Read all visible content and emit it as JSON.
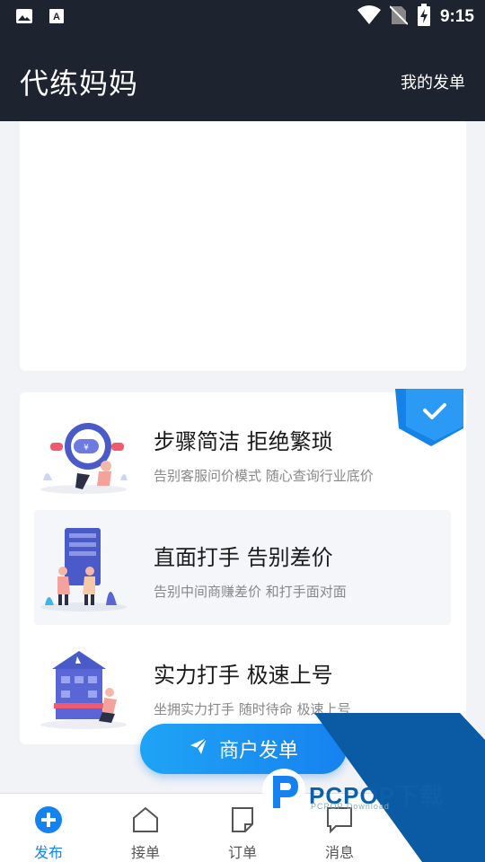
{
  "status_bar": {
    "time": "9:15",
    "left_icons": [
      "image-icon",
      "font-icon"
    ],
    "right_icons": [
      "wifi-icon",
      "no-sim-icon",
      "battery-charging-icon"
    ]
  },
  "header": {
    "title": "代练妈妈",
    "my_orders_label": "我的发单"
  },
  "features": [
    {
      "title": "步骤简洁 拒绝繁琐",
      "desc": "告别客服问价模式 随心查询行业底价",
      "icon": "currency-bubble-illustration"
    },
    {
      "title": "直面打手 告别差价",
      "desc": "告别中间商赚差价 和打手面对面",
      "icon": "handshake-illustration"
    },
    {
      "title": "实力打手 极速上号",
      "desc": "坐拥实力打手 随时待命 极速上号",
      "icon": "building-illustration"
    }
  ],
  "badge_icon": "check-ribbon-icon",
  "merchant_button": {
    "label": "商户发单",
    "icon": "paper-plane-icon"
  },
  "bottom_nav": [
    {
      "label": "发布",
      "icon": "plus-circle-icon",
      "active": true
    },
    {
      "label": "接单",
      "icon": "home-icon",
      "active": false
    },
    {
      "label": "订单",
      "icon": "note-icon",
      "active": false
    },
    {
      "label": "消息",
      "icon": "message-icon",
      "active": false
    }
  ],
  "watermark": {
    "text": "PCPOP下载",
    "sub": "PCPOP Download"
  },
  "colors": {
    "header_bg": "#1e2330",
    "accent": "#1682f0",
    "badge": "#2196f3"
  }
}
